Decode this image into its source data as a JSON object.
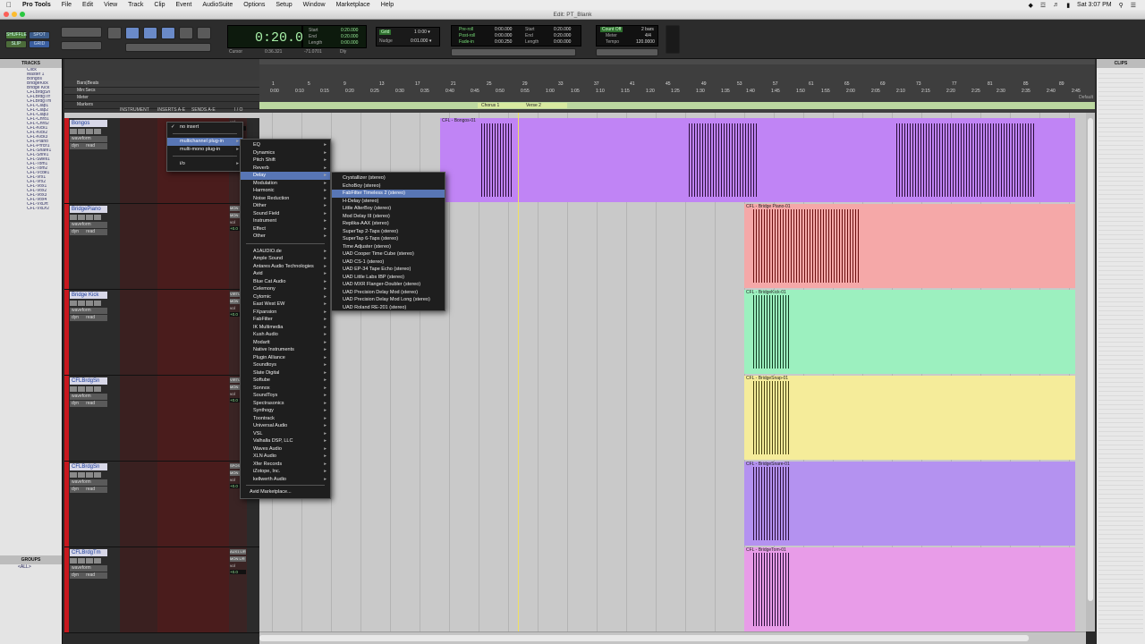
{
  "menubar": {
    "app": "Pro Tools",
    "items": [
      "File",
      "Edit",
      "View",
      "Track",
      "Clip",
      "Event",
      "AudioSuite",
      "Options",
      "Setup",
      "Window",
      "Marketplace",
      "Help"
    ],
    "clock": "Sat 3:07 PM"
  },
  "window": {
    "title": "Edit: PT_Blank"
  },
  "toolbar": {
    "edit_modes": [
      "SHUFFLE",
      "SPOT",
      "SLIP",
      "GRID"
    ],
    "main_counter": "0:20.000",
    "counter_labels": {
      "start": "Start",
      "end": "End",
      "length": "Length",
      "cursor": "Cursor"
    },
    "sel_start": "0:20.000",
    "sel_end": "0:20.000",
    "sel_length": "0:00.000",
    "cursor_val": "0:36.321",
    "cursor2": "-71.0701",
    "grid_label": "Grid",
    "nudge_label": "Nudge",
    "grid_val": "1 0:00 ▾",
    "nudge_val": "0:01.000 ▾",
    "preroll": "Pre-roll",
    "postroll": "Post-roll",
    "fadein": "Fade-in",
    "preroll_val": "0:00.000",
    "postroll_val": "0:00.000",
    "fadein_val": "0:00.250",
    "start2": "Start",
    "end2": "End",
    "length2": "Length",
    "start2_val": "0:20.000",
    "end2_val": "0:20.000",
    "length2_val": "0:00.000",
    "count_off": "Count Off",
    "meter": "Meter",
    "tempo": "Tempo",
    "bars": "2 bars",
    "meter_val": "4/4",
    "tempo_val": "120.0000",
    "dly": "Dly"
  },
  "tracks_panel": {
    "title": "TRACKS",
    "items": [
      "Click",
      "Master 1",
      "Bongos",
      "BridgeKick",
      "Bridge Kick",
      "CFLBrdgSn",
      "CFLBrdgTrr",
      "CFLBrdgTm",
      "CFL-Clap1",
      "CFL-Clap2",
      "CFL-Clap3",
      "CFL-Chrd1",
      "CFL-Chrd2",
      "CFL-Kick1",
      "CFL-Kick2",
      "CFL-Kick3",
      "CFL-Piano",
      "CFL-Prrclf1",
      "CFL-Snare1",
      "CFL-Snre1",
      "CFL-Swell1",
      "CFL-Tom1",
      "CFL-Tom2",
      "CFL-Vcde1",
      "CFL-Vrx1",
      "CFL-Vrx2",
      "CFL-Vox1",
      "CFL-Vox2",
      "CFL-Vox3",
      "CFL-Vox4",
      "CFL-VxDrt",
      "CFL-VxDr2"
    ]
  },
  "groups_panel": {
    "title": "GROUPS",
    "all": "<ALL>"
  },
  "clips_panel": {
    "title": "CLIPS"
  },
  "ruler": {
    "rows": [
      "Bars|Beats",
      "Min:Secs",
      "Meter",
      "Markers"
    ],
    "markers": [
      "Chorus 1",
      "Verse 2"
    ],
    "default_label": "Default",
    "bars": [
      "1",
      "5",
      "9",
      "13",
      "17",
      "21",
      "25",
      "29",
      "33",
      "37",
      "41",
      "45",
      "49",
      "53",
      "57",
      "61",
      "65",
      "69",
      "73",
      "77",
      "81",
      "85",
      "89"
    ],
    "secs": [
      "0:00",
      "0:10",
      "0:15",
      "0:20",
      "0:25",
      "0:30",
      "0:35",
      "0:40",
      "0:45",
      "0:50",
      "0:55",
      "1:00",
      "1:05",
      "1:10",
      "1:15",
      "1:20",
      "1:25",
      "1:30",
      "1:35",
      "1:40",
      "1:45",
      "1:50",
      "1:55",
      "2:00",
      "2:05",
      "2:10",
      "2:15",
      "2:20",
      "2:25",
      "2:30",
      "2:35",
      "2:40",
      "2:45"
    ]
  },
  "mix_columns": [
    "INSTRUMENT",
    "INSERTS A-E",
    "SENDS A-E",
    "I / O"
  ],
  "tracks": [
    {
      "name": "Bongos",
      "mode": "waveform",
      "dyn": "dyn",
      "read": "read",
      "vol": "vol",
      "volval": "+0.0",
      "color": "#c084f5",
      "clip": "CFL - Bongos-01"
    },
    {
      "name": "BridgePiano",
      "mode": "waveform",
      "dyn": "dyn",
      "read": "read",
      "vol": "vol",
      "volval": "+0.0",
      "color": "#f5a8a8",
      "clip": "CFL - Bridge Piano-01",
      "io1": "MON 1",
      "io2": "MON 1"
    },
    {
      "name": "Bridge Kick",
      "mode": "waveform",
      "dyn": "dyn",
      "read": "read",
      "vol": "vol",
      "volval": "+0.0",
      "color": "#9cf0bf",
      "clip": "CFL - BridgeKick-01",
      "io1": "VIRTUAL",
      "io2": "MON 1"
    },
    {
      "name": "CFLBrdgSn",
      "mode": "waveform",
      "dyn": "dyn",
      "read": "read",
      "vol": "vol",
      "volval": "+0.0",
      "color": "#f5ec9a",
      "clip": "CFL - BridgeSnap-01",
      "io1": "VIRTUAL",
      "io2": "MON 1"
    },
    {
      "name": "CFLBrdgSn",
      "mode": "waveform",
      "dyn": "dyn",
      "read": "read",
      "vol": "vol",
      "volval": "+0.0",
      "color": "#b492f0",
      "clip": "CFL - BridgeSnare-01",
      "io1": "SPOST",
      "io2": "MON 1"
    },
    {
      "name": "CFLBrdgTm",
      "mode": "waveform",
      "dyn": "dyn",
      "read": "read",
      "vol": "vol",
      "volval": "+0.0",
      "color": "#e89ce8",
      "clip": "CFL - BridgeTom-01",
      "io1": "AUX1 L/R",
      "io2": "MON L/R"
    }
  ],
  "insert_menu": {
    "items": [
      "no insert",
      "multichannel plug-in",
      "multi-mono plug-in",
      "i/o"
    ]
  },
  "category_menu": {
    "categories": [
      "EQ",
      "Dynamics",
      "Pitch Shift",
      "Reverb",
      "Delay",
      "Modulation",
      "Harmonic",
      "Noise Reduction",
      "Dither",
      "Sound Field",
      "Instrument",
      "Effect",
      "Other"
    ],
    "vendors": [
      "A1AUDIO.de",
      "Ample Sound",
      "Antares Audio Technologies",
      "Avid",
      "Blue Cat Audio",
      "Celemony",
      "Cytomic",
      "East West EW",
      "FXpansion",
      "FabFilter",
      "IK Multimedia",
      "Kush Audio",
      "Modartt",
      "Native Instruments",
      "Plugin Alliance",
      "Soundtoys",
      "Slate Digital",
      "Softube",
      "Sonnox",
      "SoundToys",
      "Spectrasonics",
      "Synthogy",
      "Toontrack",
      "Universal Audio",
      "VSL",
      "Valhalla DSP, LLC",
      "Waves Audio",
      "XLN Audio",
      "Xfer Records",
      "iZotope, Inc.",
      "kellwerth Audio"
    ],
    "marketplace": "Avid Marketplace..."
  },
  "delay_menu": {
    "items": [
      "Crystallizer (stereo)",
      "EchoBoy (stereo)",
      "FabFilter Timeless 2 (stereo)",
      "H-Delay (stereo)",
      "Little AlterBoy (stereo)",
      "Mod Delay III (stereo)",
      "Replika-AAX (stereo)",
      "SuperTap 2-Taps (stereo)",
      "SuperTap 6-Taps (stereo)",
      "Time Adjuster (stereo)",
      "UAD Cooper Time Cube (stereo)",
      "UAD CS-1 (stereo)",
      "UAD EP-34 Tape Echo (stereo)",
      "UAD Little Labs IBP (stereo)",
      "UAD MXR Flanger-Doubler (stereo)",
      "UAD Precision Delay Mod (stereo)",
      "UAD Precision Delay Mod Long (stereo)",
      "UAD Roland RE-201 (stereo)"
    ],
    "selected": 2
  }
}
